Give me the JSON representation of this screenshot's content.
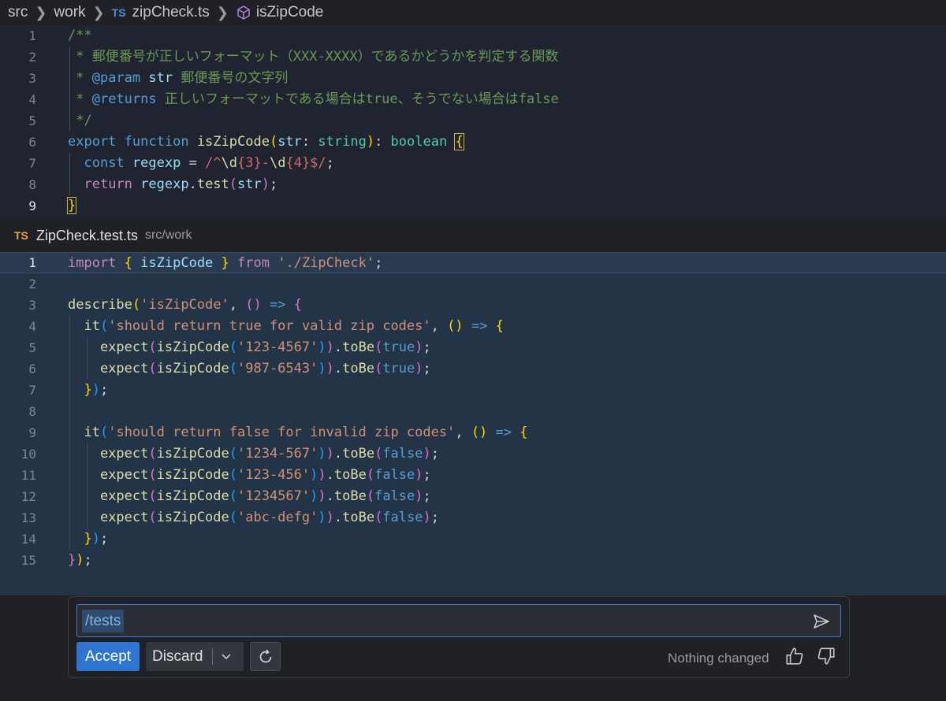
{
  "breadcrumb": {
    "parts": [
      "src",
      "work"
    ],
    "file_badge": "TS",
    "file": "zipCheck.ts",
    "symbol": "isZipCode"
  },
  "editor1": {
    "line_numbers": [
      "1",
      "2",
      "3",
      "4",
      "5",
      "6",
      "7",
      "8",
      "9"
    ],
    "active_line": "9",
    "lines": [
      [
        [
          "cm",
          "/**"
        ]
      ],
      [
        [
          "cm",
          " * 郵便番号が正しいフォーマット（XXX-XXXX）であるかどうかを判定する関数"
        ]
      ],
      [
        [
          "cm",
          " * "
        ],
        [
          "cmk",
          "@param"
        ],
        [
          "cm",
          " "
        ],
        [
          "id",
          "str"
        ],
        [
          "cm",
          " 郵便番号の文字列"
        ]
      ],
      [
        [
          "cm",
          " * "
        ],
        [
          "cmk",
          "@returns"
        ],
        [
          "cm",
          " 正しいフォーマットである場合はtrue、そうでない場合はfalse"
        ]
      ],
      [
        [
          "cm",
          " */"
        ]
      ],
      [
        [
          "kw",
          "export"
        ],
        [
          "pl",
          " "
        ],
        [
          "kw",
          "function"
        ],
        [
          "pl",
          " "
        ],
        [
          "fn",
          "isZipCode"
        ],
        [
          "b1",
          "("
        ],
        [
          "id",
          "str"
        ],
        [
          "pl",
          ": "
        ],
        [
          "ty",
          "string"
        ],
        [
          "b1",
          ")"
        ],
        [
          "pl",
          ": "
        ],
        [
          "ty",
          "boolean"
        ],
        [
          "pl",
          " "
        ],
        [
          "b1box",
          "{"
        ]
      ],
      [
        [
          "pl",
          "  "
        ],
        [
          "kw",
          "const"
        ],
        [
          "pl",
          " "
        ],
        [
          "id",
          "regexp"
        ],
        [
          "pl",
          " = "
        ],
        [
          "rx",
          "/^"
        ],
        [
          "rxs",
          "\\d"
        ],
        [
          "rx",
          "{3}-"
        ],
        [
          "rxs",
          "\\d"
        ],
        [
          "rx",
          "{4}$/"
        ],
        [
          "pl",
          ";"
        ]
      ],
      [
        [
          "pl",
          "  "
        ],
        [
          "kwp",
          "return"
        ],
        [
          "pl",
          " "
        ],
        [
          "id",
          "regexp"
        ],
        [
          "pl",
          "."
        ],
        [
          "fn",
          "test"
        ],
        [
          "b2",
          "("
        ],
        [
          "id",
          "str"
        ],
        [
          "b2",
          ")"
        ],
        [
          "pl",
          ";"
        ]
      ],
      [
        [
          "b1box",
          "}"
        ]
      ]
    ]
  },
  "tab": {
    "badge": "TS",
    "filename": "ZipCheck.test.ts",
    "path": "src/work"
  },
  "editor2": {
    "line_numbers": [
      "1",
      "2",
      "3",
      "4",
      "5",
      "6",
      "7",
      "8",
      "9",
      "10",
      "11",
      "12",
      "13",
      "14",
      "15"
    ],
    "active_line": "1",
    "lines": [
      [
        [
          "kwp",
          "import"
        ],
        [
          "pl",
          " "
        ],
        [
          "b1",
          "{"
        ],
        [
          "pl",
          " "
        ],
        [
          "id",
          "isZipCode"
        ],
        [
          "pl",
          " "
        ],
        [
          "b1",
          "}"
        ],
        [
          "pl",
          " "
        ],
        [
          "kwp",
          "from"
        ],
        [
          "pl",
          " "
        ],
        [
          "st",
          "'./ZipCheck'"
        ],
        [
          "pl",
          ";"
        ]
      ],
      [],
      [
        [
          "fn",
          "describe"
        ],
        [
          "b1",
          "("
        ],
        [
          "st",
          "'isZipCode'"
        ],
        [
          "pl",
          ", "
        ],
        [
          "b2",
          "()"
        ],
        [
          "pl",
          " "
        ],
        [
          "kw",
          "=>"
        ],
        [
          "pl",
          " "
        ],
        [
          "b2",
          "{"
        ]
      ],
      [
        [
          "pl",
          "  "
        ],
        [
          "fn",
          "it"
        ],
        [
          "b3",
          "("
        ],
        [
          "st",
          "'should return true for valid zip codes'"
        ],
        [
          "pl",
          ", "
        ],
        [
          "b1",
          "()"
        ],
        [
          "pl",
          " "
        ],
        [
          "kw",
          "=>"
        ],
        [
          "pl",
          " "
        ],
        [
          "b1",
          "{"
        ]
      ],
      [
        [
          "pl",
          "    "
        ],
        [
          "fn",
          "expect"
        ],
        [
          "b2",
          "("
        ],
        [
          "fn",
          "isZipCode"
        ],
        [
          "b3",
          "("
        ],
        [
          "st",
          "'123-4567'"
        ],
        [
          "b3",
          ")"
        ],
        [
          "b2",
          ")"
        ],
        [
          "pl",
          "."
        ],
        [
          "fn",
          "toBe"
        ],
        [
          "b2",
          "("
        ],
        [
          "bl",
          "true"
        ],
        [
          "b2",
          ")"
        ],
        [
          "pl",
          ";"
        ]
      ],
      [
        [
          "pl",
          "    "
        ],
        [
          "fn",
          "expect"
        ],
        [
          "b2",
          "("
        ],
        [
          "fn",
          "isZipCode"
        ],
        [
          "b3",
          "("
        ],
        [
          "st",
          "'987-6543'"
        ],
        [
          "b3",
          ")"
        ],
        [
          "b2",
          ")"
        ],
        [
          "pl",
          "."
        ],
        [
          "fn",
          "toBe"
        ],
        [
          "b2",
          "("
        ],
        [
          "bl",
          "true"
        ],
        [
          "b2",
          ")"
        ],
        [
          "pl",
          ";"
        ]
      ],
      [
        [
          "pl",
          "  "
        ],
        [
          "b1",
          "}"
        ],
        [
          "b3",
          ")"
        ],
        [
          "pl",
          ";"
        ]
      ],
      [],
      [
        [
          "pl",
          "  "
        ],
        [
          "fn",
          "it"
        ],
        [
          "b3",
          "("
        ],
        [
          "st",
          "'should return false for invalid zip codes'"
        ],
        [
          "pl",
          ", "
        ],
        [
          "b1",
          "()"
        ],
        [
          "pl",
          " "
        ],
        [
          "kw",
          "=>"
        ],
        [
          "pl",
          " "
        ],
        [
          "b1",
          "{"
        ]
      ],
      [
        [
          "pl",
          "    "
        ],
        [
          "fn",
          "expect"
        ],
        [
          "b2",
          "("
        ],
        [
          "fn",
          "isZipCode"
        ],
        [
          "b3",
          "("
        ],
        [
          "st",
          "'1234-567'"
        ],
        [
          "b3",
          ")"
        ],
        [
          "b2",
          ")"
        ],
        [
          "pl",
          "."
        ],
        [
          "fn",
          "toBe"
        ],
        [
          "b2",
          "("
        ],
        [
          "bl",
          "false"
        ],
        [
          "b2",
          ")"
        ],
        [
          "pl",
          ";"
        ]
      ],
      [
        [
          "pl",
          "    "
        ],
        [
          "fn",
          "expect"
        ],
        [
          "b2",
          "("
        ],
        [
          "fn",
          "isZipCode"
        ],
        [
          "b3",
          "("
        ],
        [
          "st",
          "'123-456'"
        ],
        [
          "b3",
          ")"
        ],
        [
          "b2",
          ")"
        ],
        [
          "pl",
          "."
        ],
        [
          "fn",
          "toBe"
        ],
        [
          "b2",
          "("
        ],
        [
          "bl",
          "false"
        ],
        [
          "b2",
          ")"
        ],
        [
          "pl",
          ";"
        ]
      ],
      [
        [
          "pl",
          "    "
        ],
        [
          "fn",
          "expect"
        ],
        [
          "b2",
          "("
        ],
        [
          "fn",
          "isZipCode"
        ],
        [
          "b3",
          "("
        ],
        [
          "st",
          "'1234567'"
        ],
        [
          "b3",
          ")"
        ],
        [
          "b2",
          ")"
        ],
        [
          "pl",
          "."
        ],
        [
          "fn",
          "toBe"
        ],
        [
          "b2",
          "("
        ],
        [
          "bl",
          "false"
        ],
        [
          "b2",
          ")"
        ],
        [
          "pl",
          ";"
        ]
      ],
      [
        [
          "pl",
          "    "
        ],
        [
          "fn",
          "expect"
        ],
        [
          "b2",
          "("
        ],
        [
          "fn",
          "isZipCode"
        ],
        [
          "b3",
          "("
        ],
        [
          "st",
          "'abc-defg'"
        ],
        [
          "b3",
          ")"
        ],
        [
          "b2",
          ")"
        ],
        [
          "pl",
          "."
        ],
        [
          "fn",
          "toBe"
        ],
        [
          "b2",
          "("
        ],
        [
          "bl",
          "false"
        ],
        [
          "b2",
          ")"
        ],
        [
          "pl",
          ";"
        ]
      ],
      [
        [
          "pl",
          "  "
        ],
        [
          "b1",
          "}"
        ],
        [
          "b3",
          ")"
        ],
        [
          "pl",
          ";"
        ]
      ],
      [
        [
          "b2",
          "}"
        ],
        [
          "b1",
          ")"
        ],
        [
          "pl",
          ";"
        ]
      ]
    ]
  },
  "chat": {
    "command": "/tests",
    "accept_label": "Accept",
    "discard_label": "Discard",
    "status": "Nothing changed",
    "icons": [
      "send-icon",
      "chevron-down-icon",
      "refresh-icon",
      "thumbs-up-icon",
      "thumbs-down-icon",
      "symbol-method-icon"
    ],
    "accent_color": "#2f74d0"
  }
}
